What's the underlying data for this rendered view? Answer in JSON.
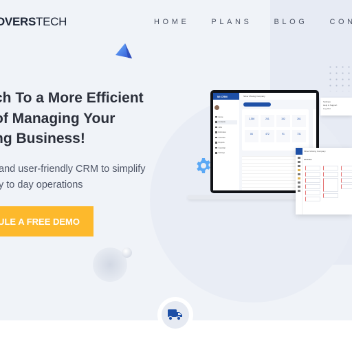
{
  "brand": {
    "logo_bold": "OVERS",
    "logo_light": "TECH"
  },
  "nav": {
    "items": [
      "HOME",
      "PLANS",
      "BLOG",
      "CONT"
    ]
  },
  "hero": {
    "headline_lines": [
      "ch To a More Efficient",
      "of Managing Your",
      "ng Business!"
    ],
    "subtext_lines": [
      "and user-friendly CRM to simplify",
      "y to day operations"
    ],
    "cta_label": "DULE A FREE DEMO"
  },
  "mockup": {
    "app_name": "MI CRM",
    "company": "Silver Moving Company",
    "stats": [
      "1,350",
      "241",
      "152",
      "261",
      "84",
      "472",
      "91",
      "731"
    ],
    "side_items": [
      "Home",
      "Contacts",
      "Jobs",
      "Estimates",
      "Activities",
      "Reports",
      "Calendar",
      "Settings"
    ],
    "panel_title": "Silver Moving Company",
    "panel_sub": "All Jobs",
    "menu_items": [
      "Settings",
      "Help & Support",
      "Log Out"
    ]
  },
  "colors": {
    "accent": "#fdb92c",
    "brand_blue": "#1d4fa6",
    "hero_bg": "#f0f3f8"
  },
  "icons": {
    "truck": "truck-icon",
    "gear": "gear-icon",
    "pyramid": "pyramid-shape-icon"
  }
}
